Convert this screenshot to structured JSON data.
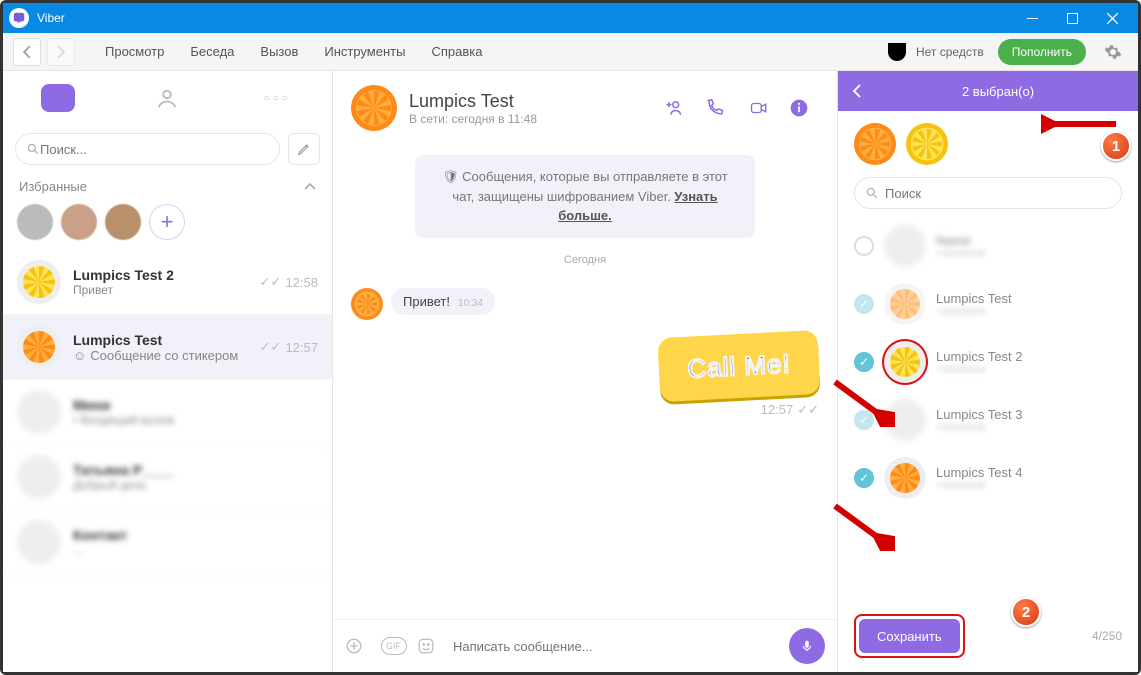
{
  "titlebar": {
    "app": "Viber"
  },
  "toolbar": {
    "menu": [
      "Просмотр",
      "Беседа",
      "Вызов",
      "Инструменты",
      "Справка"
    ],
    "balance": "Нет средств",
    "topup": "Пополнить"
  },
  "left": {
    "search_ph": "Поиск...",
    "fav_label": "Избранные",
    "chats": [
      {
        "name": "Lumpics Test 2",
        "preview": "Привет",
        "time": "12:58",
        "avatar": "lemon"
      },
      {
        "name": "Lumpics Test",
        "preview": "Сообщение со стикером",
        "time": "12:57",
        "avatar": "orange",
        "active": true,
        "sticker": true
      }
    ]
  },
  "mid": {
    "name": "Lumpics Test",
    "status": "В сети: сегодня в 11:48",
    "encryption": "Сообщения, которые вы отправляете в этот чат, защищены шифрованием Viber.",
    "encryption_link": "Узнать больше.",
    "day": "Сегодня",
    "msg1": "Привет!",
    "msg1_time": "10:34",
    "sticker_text": "Call Me!",
    "sticker_time": "12:57",
    "compose_ph": "Написать сообщение..."
  },
  "right": {
    "title": "2 выбран(о)",
    "search_ph": "Поиск",
    "items": [
      {
        "name": "",
        "avatar": "blur",
        "checked": "off"
      },
      {
        "name": "Lumpics Test",
        "avatar": "orange",
        "checked": "ghost"
      },
      {
        "name": "Lumpics Test 2",
        "avatar": "lemon",
        "checked": "on",
        "arrow": true,
        "ring": true
      },
      {
        "name": "Lumpics Test 3",
        "avatar": "blur",
        "checked": "ghost"
      },
      {
        "name": "Lumpics Test 4",
        "avatar": "orange",
        "checked": "on",
        "arrow": true
      }
    ],
    "save": "Сохранить",
    "counter": "4/250"
  },
  "badges": {
    "b1": "1",
    "b2": "2"
  }
}
